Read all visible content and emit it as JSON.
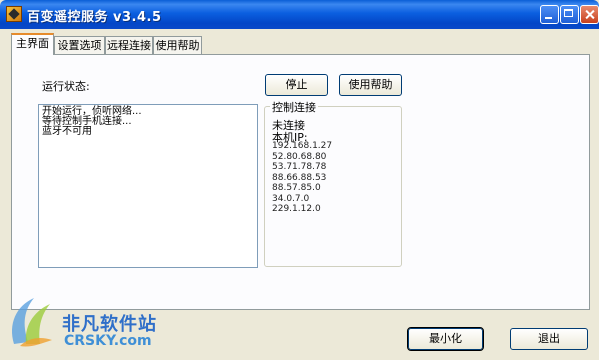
{
  "window": {
    "title": "百变遥控服务  v3.4.5"
  },
  "tabs": [
    {
      "label": "主界面",
      "active": true
    },
    {
      "label": "设置选项",
      "active": false
    },
    {
      "label": "远程连接",
      "active": false
    },
    {
      "label": "使用帮助",
      "active": false
    }
  ],
  "main": {
    "status_label": "运行状态:",
    "log_lines": [
      "开始运行，侦听网络...",
      "等待控制手机连接...",
      "蓝牙不可用"
    ],
    "stop_button": "停止",
    "help_button": "使用帮助"
  },
  "control": {
    "group_title": "控制连接",
    "connection_status": "未连接",
    "ip_title": "本机IP:",
    "ips": [
      "192.168.1.27",
      "52.80.68.80",
      "53.71.78.78",
      "88.66.88.53",
      "88.57.85.0",
      "34.0.7.0",
      "229.1.12.0"
    ]
  },
  "footer": {
    "minimize_button": "最小化",
    "exit_button": "退出"
  },
  "watermark": {
    "brand": "非凡软件站",
    "site": "CRSKY.com"
  },
  "colors": {
    "titlebar": "#0a5ed6",
    "tab_accent": "#e68b2c",
    "window_bg": "#ece9d8",
    "watermark_blue": "#2f6fc9"
  }
}
